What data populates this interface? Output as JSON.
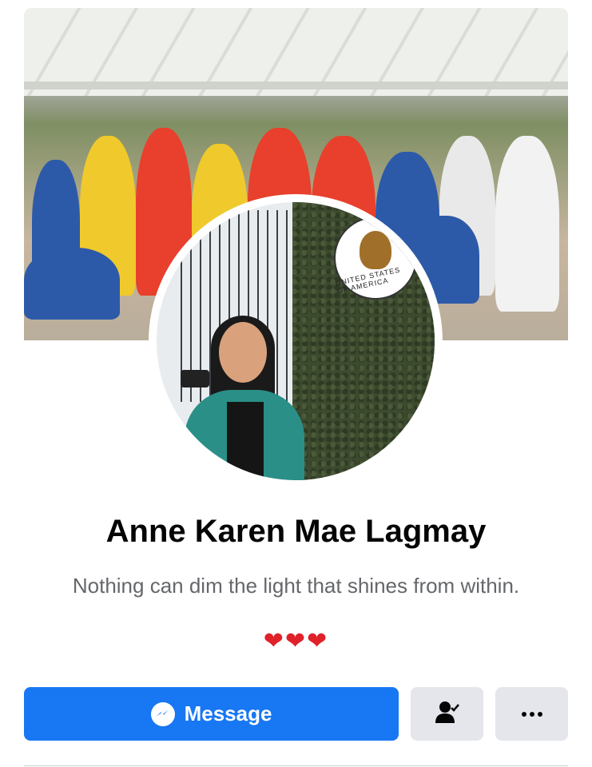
{
  "profile": {
    "name": "Anne Karen Mae Lagmay",
    "bio": "Nothing can dim the light that shines from within.",
    "hearts": "❤❤❤"
  },
  "cover": {
    "banner_seal_text": "UNITED STATES OF AMERICA"
  },
  "actions": {
    "message_label": "Message",
    "friend_icon": "friends-check-icon",
    "more_icon": "more-dots-icon"
  },
  "colors": {
    "primary": "#1877f2",
    "secondary_button": "#e4e6eb",
    "text_primary": "#050505",
    "text_secondary": "#65676b"
  }
}
